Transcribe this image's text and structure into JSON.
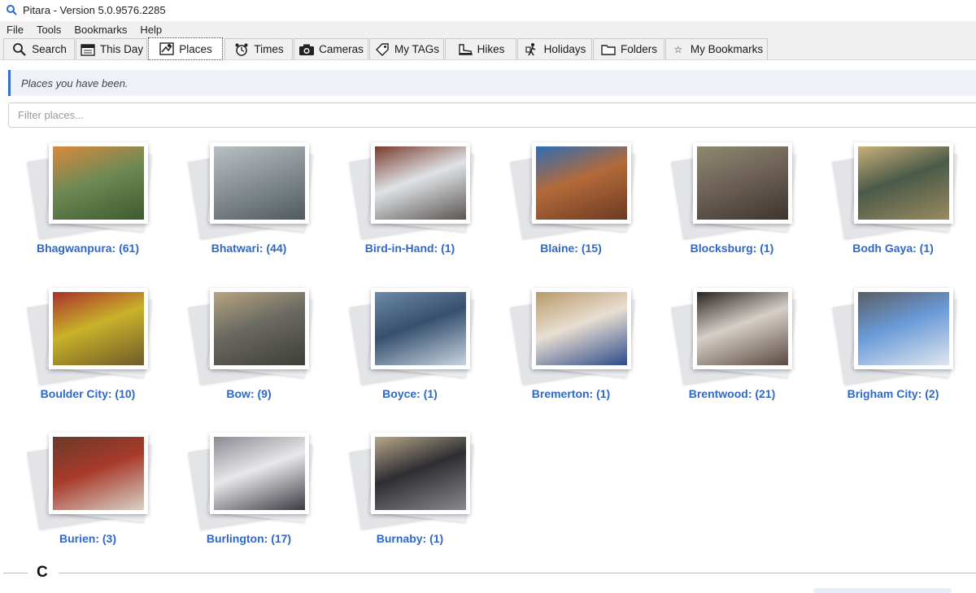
{
  "window": {
    "title": "Pitara - Version 5.0.9576.2285",
    "icon": "magnifier-icon"
  },
  "menu": [
    "File",
    "Tools",
    "Bookmarks",
    "Help"
  ],
  "tabs": [
    {
      "label": "Search",
      "icon": "search-icon",
      "active": false
    },
    {
      "label": "This Day",
      "icon": "calendar-icon",
      "active": false
    },
    {
      "label": "Places",
      "icon": "map-icon",
      "active": true
    },
    {
      "label": "Times",
      "icon": "alarm-clock-icon",
      "active": false
    },
    {
      "label": "Cameras",
      "icon": "camera-icon",
      "active": false
    },
    {
      "label": "My TAGs",
      "icon": "tag-icon",
      "active": false
    },
    {
      "label": "Hikes",
      "icon": "boot-icon",
      "active": false
    },
    {
      "label": "Holidays",
      "icon": "traveler-icon",
      "active": false
    },
    {
      "label": "Folders",
      "icon": "folder-icon",
      "active": false
    },
    {
      "label": "My Bookmarks",
      "icon": "star-icon",
      "active": false
    }
  ],
  "banner": {
    "text": "Places you have been."
  },
  "filter": {
    "placeholder": "Filter places...",
    "value": ""
  },
  "places": [
    {
      "label": "Bhagwanpura: (61)",
      "colors": [
        "#6f8a55",
        "#3f5a2e",
        "#d98a3c"
      ]
    },
    {
      "label": "Bhatwari: (44)",
      "colors": [
        "#8a9296",
        "#4f5a60",
        "#b8c0c4"
      ]
    },
    {
      "label": "Bird-in-Hand: (1)",
      "colors": [
        "#dfe3e6",
        "#5b5552",
        "#7a3b2e"
      ]
    },
    {
      "label": "Blaine: (15)",
      "colors": [
        "#b46a3a",
        "#6b3a22",
        "#2e6db5"
      ]
    },
    {
      "label": "Blocksburg: (1)",
      "colors": [
        "#6e6258",
        "#3e352e",
        "#8e8a6e"
      ]
    },
    {
      "label": "Bodh Gaya: (1)",
      "colors": [
        "#4a5a48",
        "#9a8a60",
        "#c9b07a"
      ]
    },
    {
      "label": "Boulder City: (10)",
      "colors": [
        "#c9b22a",
        "#6e5a2a",
        "#a8322a"
      ]
    },
    {
      "label": "Bow: (9)",
      "colors": [
        "#6a6a62",
        "#3e3e38",
        "#b8a480"
      ]
    },
    {
      "label": "Boyce: (1)",
      "colors": [
        "#36506e",
        "#c8d4e0",
        "#6e8aa6"
      ]
    },
    {
      "label": "Bremerton: (1)",
      "colors": [
        "#e8ded2",
        "#2e4a8a",
        "#b89a6a"
      ]
    },
    {
      "label": "Brentwood: (21)",
      "colors": [
        "#d6cfc8",
        "#5a4a40",
        "#2a2420"
      ]
    },
    {
      "label": "Brigham City: (2)",
      "colors": [
        "#6a9ad8",
        "#dfe6ee",
        "#5a5e66"
      ]
    },
    {
      "label": "Burien: (3)",
      "colors": [
        "#a83a2a",
        "#d8d2c8",
        "#6a3a2a"
      ]
    },
    {
      "label": "Burlington: (17)",
      "colors": [
        "#e8e8ea",
        "#3a3a42",
        "#8a8a92"
      ]
    },
    {
      "label": "Burnaby: (1)",
      "colors": [
        "#2e2e32",
        "#8a8a8e",
        "#b8a88a"
      ]
    }
  ],
  "section": {
    "letter": "C"
  }
}
